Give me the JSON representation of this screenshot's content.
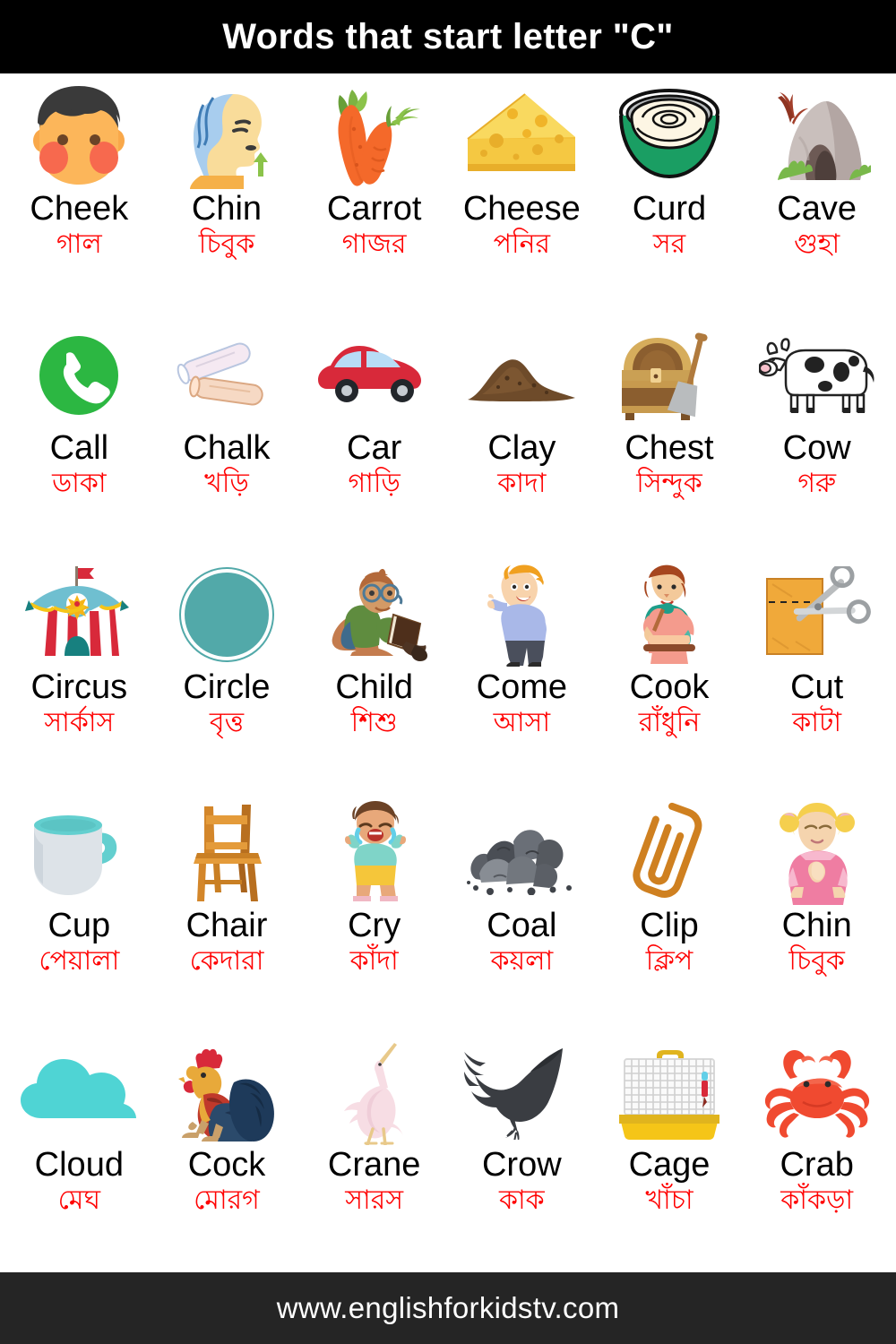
{
  "header": {
    "title": "Words that start letter \"C\""
  },
  "footer": {
    "website": "www.englishforkidstv.com"
  },
  "colors": {
    "header_bg": "#000000",
    "footer_bg": "#252525",
    "page_bg": "#ffffff",
    "english_text": "#000000",
    "bengali_text": "#ff0000"
  },
  "cells": [
    {
      "icon": "face-cheek-icon",
      "en": "Cheek",
      "bn": "গাল"
    },
    {
      "icon": "head-profile-chin-icon",
      "en": "Chin",
      "bn": "চিবুক"
    },
    {
      "icon": "carrot-icon",
      "en": "Carrot",
      "bn": "গাজর"
    },
    {
      "icon": "cheese-wedge-icon",
      "en": "Cheese",
      "bn": "পনির"
    },
    {
      "icon": "curd-bowl-icon",
      "en": "Curd",
      "bn": "সর"
    },
    {
      "icon": "cave-icon",
      "en": "Cave",
      "bn": "গুহা"
    },
    {
      "icon": "phone-call-icon",
      "en": "Call",
      "bn": "ডাকা"
    },
    {
      "icon": "chalk-sticks-icon",
      "en": "Chalk",
      "bn": "খড়ি"
    },
    {
      "icon": "red-car-icon",
      "en": "Car",
      "bn": "গাড়ি"
    },
    {
      "icon": "clay-mound-icon",
      "en": "Clay",
      "bn": "কাদা"
    },
    {
      "icon": "treasure-chest-icon",
      "en": "Chest",
      "bn": "সিন্দুক"
    },
    {
      "icon": "cow-icon",
      "en": "Cow",
      "bn": "গরু"
    },
    {
      "icon": "circus-tent-icon",
      "en": "Circus",
      "bn": "সার্কাস"
    },
    {
      "icon": "teal-circle-icon",
      "en": "Circle",
      "bn": "বৃত্ত"
    },
    {
      "icon": "child-reading-icon",
      "en": "Child",
      "bn": "শিশু"
    },
    {
      "icon": "boy-waving-icon",
      "en": "Come",
      "bn": "আসা"
    },
    {
      "icon": "cook-woman-icon",
      "en": "Cook",
      "bn": "রাঁধুনি"
    },
    {
      "icon": "scissors-cut-icon",
      "en": "Cut",
      "bn": "কাটা"
    },
    {
      "icon": "mug-cup-icon",
      "en": "Cup",
      "bn": "পেয়ালা"
    },
    {
      "icon": "wooden-chair-icon",
      "en": "Chair",
      "bn": "কেদারা"
    },
    {
      "icon": "crying-child-icon",
      "en": "Cry",
      "bn": "কাঁদা"
    },
    {
      "icon": "coal-rocks-icon",
      "en": "Coal",
      "bn": "কয়লা"
    },
    {
      "icon": "paper-clip-icon",
      "en": "Clip",
      "bn": "ক্লিপ"
    },
    {
      "icon": "girl-chin-icon",
      "en": "Chin",
      "bn": "চিবুক"
    },
    {
      "icon": "cloud-icon",
      "en": "Cloud",
      "bn": "মেঘ"
    },
    {
      "icon": "rooster-icon",
      "en": "Cock",
      "bn": "মোরগ"
    },
    {
      "icon": "crane-bird-icon",
      "en": "Crane",
      "bn": "সারস"
    },
    {
      "icon": "crow-icon",
      "en": "Crow",
      "bn": "কাক"
    },
    {
      "icon": "birdcage-icon",
      "en": "Cage",
      "bn": "খাঁচা"
    },
    {
      "icon": "crab-icon",
      "en": "Crab",
      "bn": "কাঁকড়া"
    }
  ]
}
